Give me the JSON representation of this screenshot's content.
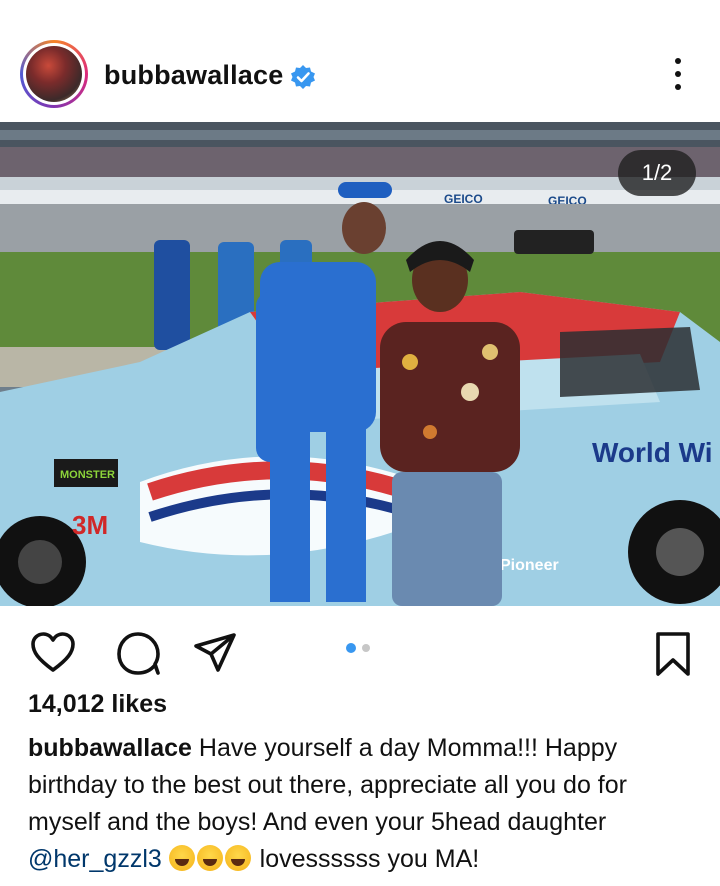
{
  "post": {
    "username": "bubbawallace",
    "verified_icon": "verified-badge-icon",
    "more_icon": "more-options-icon",
    "image_counter": "1/2",
    "likes": "14,012 likes",
    "caption": {
      "username": "bubbawallace",
      "text_1": " Have yourself a day Momma!!! Happy birthday to the best out there, appreciate all you do for myself and the boys! And even your 5head daughter ",
      "mention": "@her_gzzl3",
      "text_2": " lovessssss you MA!"
    }
  },
  "photo": {
    "sponsor_signs": [
      "GEICO",
      "GEICO"
    ],
    "car_text": [
      "World Wi",
      "Pioneer",
      "3M",
      "MONSTER"
    ]
  },
  "actions": {
    "icons": [
      "heart-icon",
      "comment-icon",
      "share-icon",
      "bookmark-icon"
    ]
  },
  "colors": {
    "verified": "#3897f0",
    "mention": "#00376b",
    "carousel_active": "#3897f0"
  }
}
